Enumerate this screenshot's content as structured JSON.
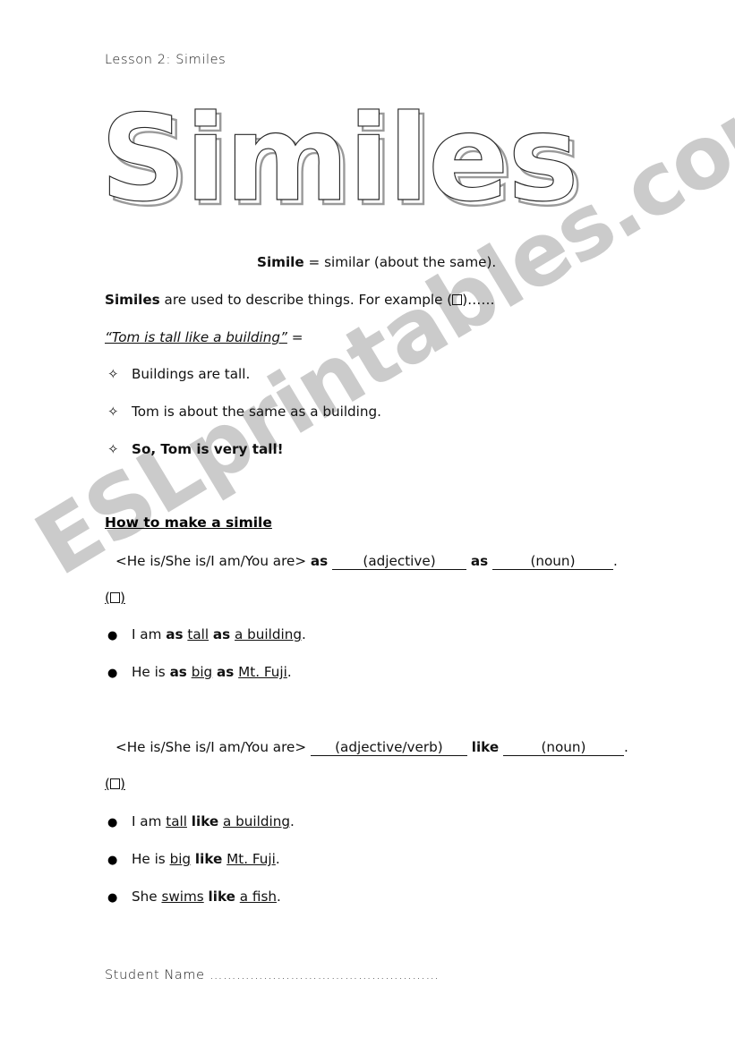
{
  "document": {
    "header_label": "Lesson 2: Similes",
    "title": "Similes",
    "watermark": "ESLprintables.com",
    "watermark_color": "#cbcbcb"
  },
  "definition": {
    "term": "Simile",
    "rest": " = similar (about the same)."
  },
  "intro": {
    "lead": "Similes",
    "rest_before_box": " are used to describe things. For example (",
    "rest_after_box": ")……"
  },
  "example_quote": {
    "quoted": "“Tom is tall like a building”",
    "equals": " ="
  },
  "reasoning_bullets": [
    {
      "marker": "✧",
      "text": "Buildings are tall.",
      "bold": false
    },
    {
      "marker": "✧",
      "text": "Tom is about the same as a building.",
      "bold": false
    },
    {
      "marker": "✧",
      "text": "So, Tom is very tall!",
      "bold": true
    }
  ],
  "how_to": {
    "heading": "How to make a simile"
  },
  "pattern_as": {
    "subject": "<He is/She is/I am/You are>",
    "keyword1": "as",
    "blank1": "(adjective)",
    "keyword2": "as",
    "blank2": "(noun)",
    "end_punct": "."
  },
  "pattern_like": {
    "subject": "<He is/She is/I am/You are>",
    "blank1": "(adjective/verb)",
    "keyword": "like",
    "blank2": "(noun)",
    "end_punct": "."
  },
  "box_marker": {
    "open": "(",
    "close": ")"
  },
  "examples_as": [
    {
      "marker": "●",
      "p1": "I am ",
      "kw1": "as",
      "p2": " ",
      "u1": "tall",
      "p3": " ",
      "kw2": "as",
      "p4": " ",
      "u2": "a building",
      "p5": "."
    },
    {
      "marker": "●",
      "p1": "He is ",
      "kw1": "as",
      "p2": " ",
      "u1": "big",
      "p3": " ",
      "kw2": "as",
      "p4": " ",
      "u2": "Mt. Fuji",
      "p5": "."
    }
  ],
  "examples_like": [
    {
      "marker": "●",
      "p1": "I am ",
      "u1": "tall",
      "p2": " ",
      "kw": "like",
      "p3": " ",
      "u2": "a building",
      "p4": "."
    },
    {
      "marker": "●",
      "p1": "He is ",
      "u1": "big",
      "p2": " ",
      "kw": "like",
      "p3": " ",
      "u2": "Mt. Fuji",
      "p4": "."
    },
    {
      "marker": "●",
      "p1": "She ",
      "u1": "swims",
      "p2": " ",
      "kw": "like",
      "p3": " ",
      "u2": "a fish",
      "p4": "."
    }
  ],
  "footer": {
    "label": "Student Name",
    "dots": " ……………………………………………"
  }
}
